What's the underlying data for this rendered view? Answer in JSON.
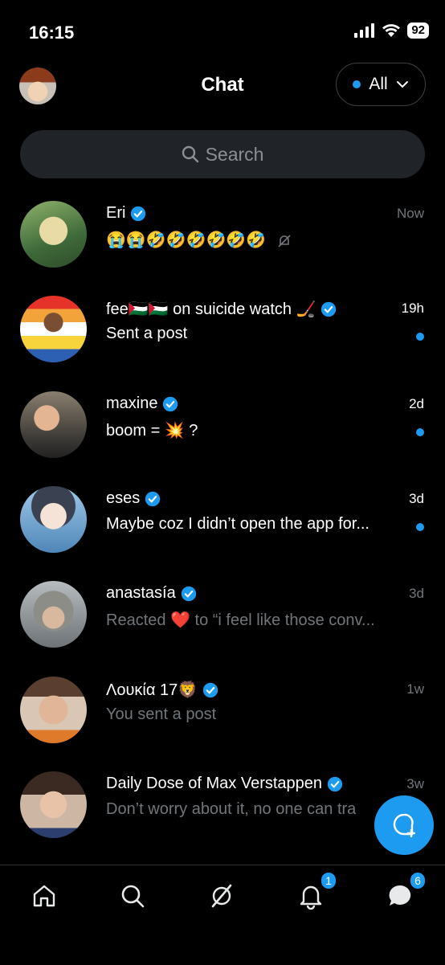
{
  "status": {
    "time": "16:15",
    "battery": "92"
  },
  "header": {
    "title": "Chat",
    "filter_label": "All"
  },
  "search": {
    "placeholder": "Search"
  },
  "conversations": [
    {
      "name": "Eri",
      "time": "Now",
      "preview": "😭😭🤣🤣🤣🤣🤣🤣",
      "unread": false,
      "muted": true
    },
    {
      "name": "fee🇵🇸🇵🇸 on suicide watch 🏒",
      "time": "19h",
      "preview": "Sent a post",
      "unread": true
    },
    {
      "name": "maxine",
      "time": "2d",
      "preview": "boom = 💥 ?",
      "unread": true
    },
    {
      "name": "eses",
      "time": "3d",
      "preview": "Maybe coz I didn’t open the app for...",
      "unread": true
    },
    {
      "name": "anastasía",
      "time": "3d",
      "preview": "Reacted ❤️ to “i feel like those conv...",
      "unread": false
    },
    {
      "name": "Λουκία 17🦁",
      "time": "1w",
      "preview": "You sent a post",
      "unread": false
    },
    {
      "name": "Daily Dose of Max Verstappen",
      "time": "3w",
      "preview": "Don’t worry about it, no one can tra",
      "unread": false
    }
  ],
  "tabs": {
    "notifications_badge": "1",
    "messages_badge": "6"
  },
  "icons": [
    "signal-icon",
    "wifi-icon",
    "chevron-down-icon",
    "search-icon",
    "verified-icon",
    "mute-icon",
    "new-message-icon",
    "home-icon",
    "explore-icon",
    "grok-icon",
    "bell-icon",
    "messages-icon"
  ],
  "colors": {
    "accent": "#1d9bf0",
    "background": "#000000",
    "muted_text": "#71767b"
  }
}
